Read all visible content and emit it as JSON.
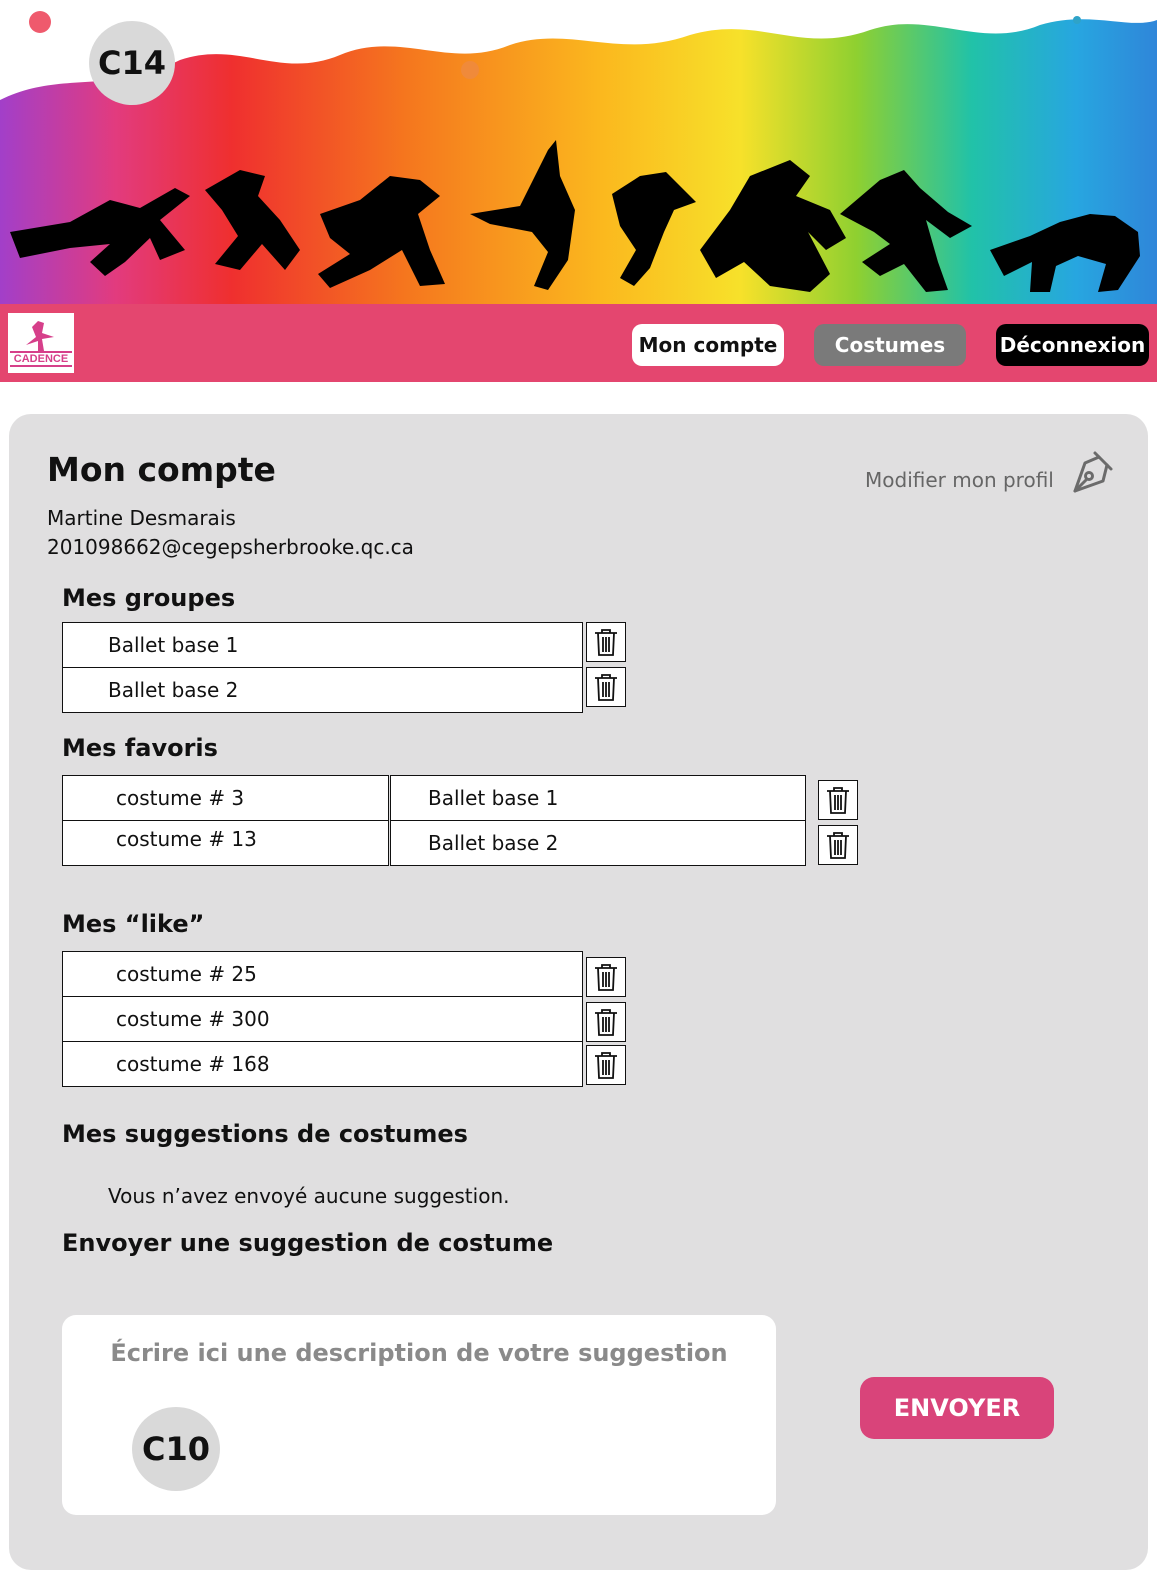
{
  "reference_badges": {
    "top": "C14",
    "suggestion": "C10"
  },
  "logo": {
    "text": "CADENCE"
  },
  "nav": {
    "account": "Mon compte",
    "costumes": "Costumes",
    "logout": "Déconnexion"
  },
  "account": {
    "title": "Mon compte",
    "name": "Martine Desmarais",
    "email": "201098662@cegepsherbrooke.qc.ca",
    "edit_profile": "Modifier mon profil"
  },
  "groups": {
    "title": "Mes groupes",
    "items": [
      "Ballet base 1",
      "Ballet base 2"
    ]
  },
  "favorites": {
    "title": "Mes favoris",
    "items": [
      {
        "costume": "costume # 3",
        "group": "Ballet base 1"
      },
      {
        "costume": "costume # 13",
        "group": "Ballet base 2"
      }
    ]
  },
  "likes": {
    "title": "Mes “like”",
    "items": [
      "costume # 25",
      "costume # 300",
      "costume # 168"
    ]
  },
  "suggestions": {
    "title": "Mes suggestions de costumes",
    "empty_message": "Vous n’avez envoyé aucune suggestion."
  },
  "send_suggestion": {
    "title": "Envoyer une suggestion de costume",
    "placeholder": "Écrire ici une description de votre suggestion",
    "button": "ENVOYER"
  },
  "icons": {
    "trash": "trash-icon",
    "edit": "pen-icon"
  },
  "colors": {
    "nav_background": "#e4466f",
    "send_button": "#d9447a",
    "panel_background": "#e0dfe0",
    "costumes_button": "#7a7a7a",
    "logout_button": "#000000"
  }
}
